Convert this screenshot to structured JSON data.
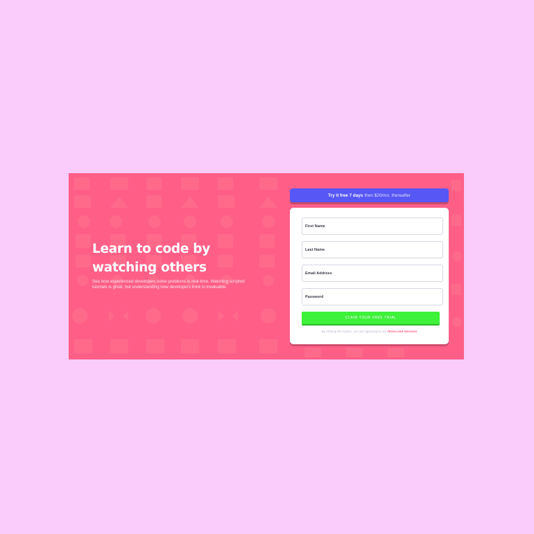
{
  "hero": {
    "headline": "Learn to code by watching others",
    "subtext": "See how experienced developers solve problems in real-time. Watching scripted tutorials is great, but understanding how developers think is invaluable."
  },
  "promo": {
    "bold": "Try it free 7 days",
    "rest": "then $20/mo. thereafter"
  },
  "form": {
    "first_name_placeholder": "First Name",
    "last_name_placeholder": "Last Name",
    "email_placeholder": "Email Address",
    "password_placeholder": "Password",
    "submit_label": "CLAIM YOUR FREE TRIAL",
    "terms_prefix": "By clicking the button, you are agreeing to our",
    "terms_link": "Terms and Services"
  },
  "colors": {
    "page_bg": "#f9ccfb",
    "hero_bg": "#ff5f87",
    "promo_bg": "#5757f5",
    "submit_bg": "#3ef13a"
  },
  "pattern_icons": [
    "calendar-icon",
    "house-icon",
    "flower-icon",
    "arrows-icon",
    "gear-icon",
    "puzzle-icon"
  ]
}
